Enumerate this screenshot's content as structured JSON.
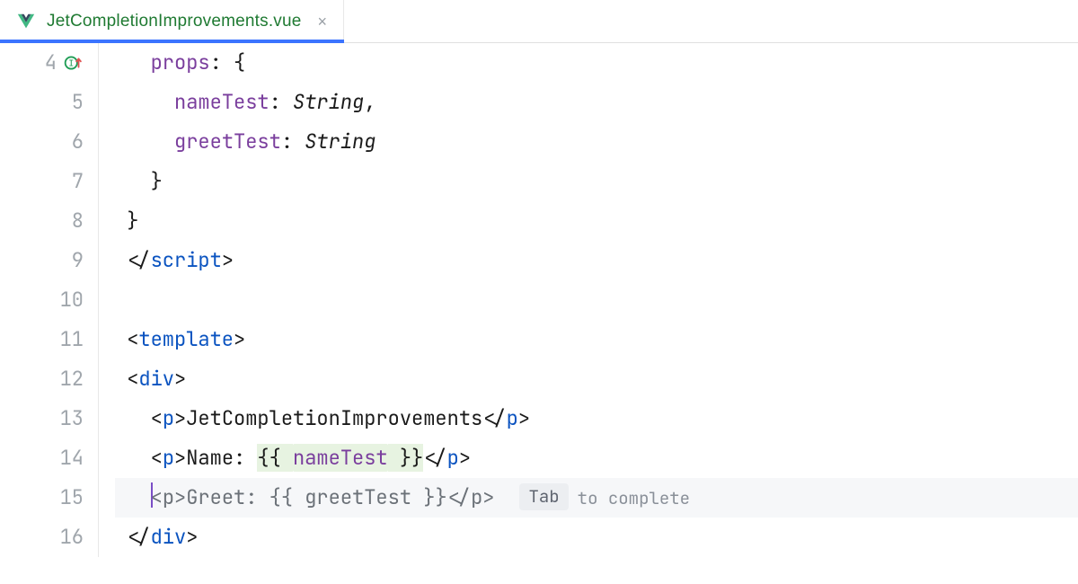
{
  "tab": {
    "filename": "JetCompletionImprovements.vue",
    "close_glyph": "×"
  },
  "gutter": {
    "start": 4,
    "end": 16,
    "implements_row": 4
  },
  "code": {
    "l4": {
      "props": "props",
      "colon_brace": ": {"
    },
    "l5": {
      "name": "nameTest",
      "colon": ": ",
      "type": "String",
      "comma": ","
    },
    "l6": {
      "name": "greetTest",
      "colon": ": ",
      "type": "String"
    },
    "l7": {
      "brace": "}"
    },
    "l8": {
      "brace": "}"
    },
    "l9": {
      "open": "</",
      "tag": "script",
      "close": ">"
    },
    "l11": {
      "open": "<",
      "tag": "template",
      "close": ">"
    },
    "l12": {
      "open": "<",
      "tag": "div",
      "close": ">"
    },
    "l13": {
      "open": "<",
      "ptag": "p",
      "mid": ">",
      "text": "JetCompletionImprovements",
      "copen": "</",
      "close2": ">"
    },
    "l14": {
      "open": "<",
      "ptag": "p",
      "mid": ">",
      "label": "Name: ",
      "mopen": "{{ ",
      "expr": "nameTest",
      "mclose": " }}",
      "copen": "</",
      "close2": ">"
    },
    "l15": {
      "open": "<",
      "ptag": "p",
      "mid": ">",
      "label": "Greet: ",
      "mopen": "{{ ",
      "expr": "greetTest",
      "mclose": " }}",
      "copen": "</",
      "close2": ">",
      "tab_label": "Tab",
      "tab_rest": "to complete"
    },
    "l16": {
      "open": "</",
      "tag": "div",
      "close": ">"
    }
  }
}
